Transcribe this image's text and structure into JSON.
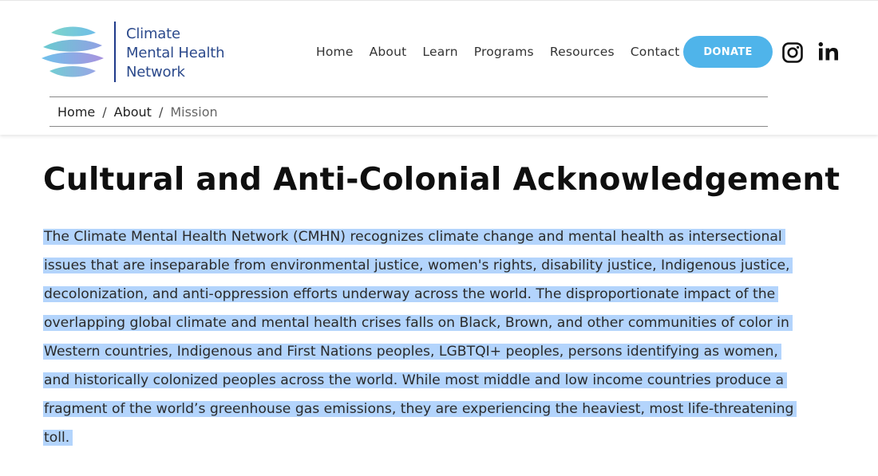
{
  "logo": {
    "lines": [
      "Climate",
      "Mental Health",
      "Network"
    ],
    "icon": "wave-sphere-logo-icon"
  },
  "nav": {
    "items": [
      "Home",
      "About",
      "Learn",
      "Programs",
      "Resources",
      "Contact"
    ]
  },
  "donate_label": "DONATE",
  "social": [
    {
      "name": "instagram-icon"
    },
    {
      "name": "linkedin-icon"
    }
  ],
  "breadcrumb": {
    "items": [
      "Home",
      "About",
      "Mission"
    ],
    "separator": "/"
  },
  "title": "Cultural and Anti-Colonial Acknowledgement",
  "paragraph_lines": [
    "The Climate Mental Health Network (CMHN) recognizes climate change and mental health as intersectional",
    "issues that are inseparable from environmental justice, women's rights, disability justice, Indigenous justice,",
    "decolonization, and anti-oppression efforts underway across the world. The disproportionate impact of the",
    "overlapping global climate and mental health crises falls on Black, Brown, and other communities of color in",
    "Western countries, Indigenous and First Nations peoples, LGBTQI+ peoples, persons identifying as women,",
    "and historically colonized peoples across the world. While most middle and low income countries produce a",
    "fragment of the world’s greenhouse gas emissions, they are experiencing the heaviest, most life-threatening",
    "toll."
  ],
  "colors": {
    "accent": "#4fb4ea",
    "logo_text": "#2c4a8c",
    "selection_highlight": "#b3d4fc"
  }
}
